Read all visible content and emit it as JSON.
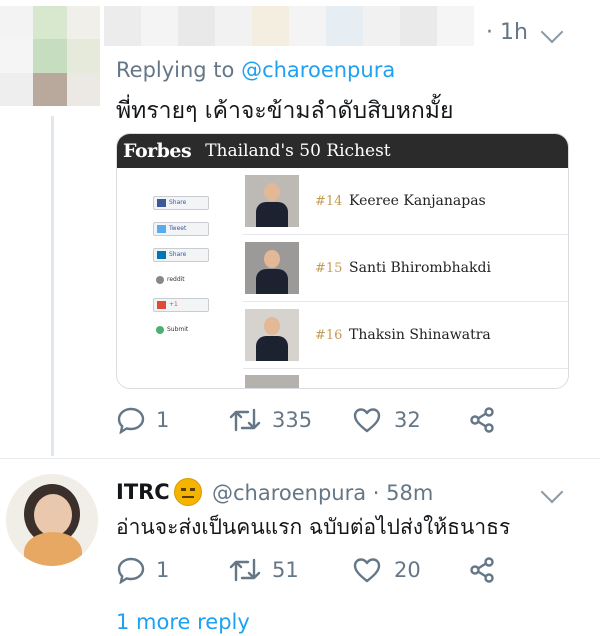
{
  "tweet1": {
    "time": "· 1h",
    "replying_prefix": "Replying to ",
    "replying_handle": "@charoenpura",
    "text": "พี่ทรายๆ เค้าจะข้ามลำดับสิบหกมั้ย",
    "card": {
      "logo": "Forbes",
      "title": "Thailand's 50 Richest",
      "share_buttons": [
        "Share",
        "Tweet",
        "Share",
        "reddit",
        "+1",
        "Submit"
      ],
      "people": [
        {
          "rank": "#14",
          "name": "Keeree Kanjanapas"
        },
        {
          "rank": "#15",
          "name": "Santi Bhirombhakdi"
        },
        {
          "rank": "#16",
          "name": "Thaksin Shinawatra"
        }
      ]
    },
    "actions": {
      "replies": "1",
      "retweets": "335",
      "likes": "32"
    }
  },
  "tweet2": {
    "name": "ITRC",
    "handle_time": "@charoenpura · 58m",
    "text": "อ่านจะส่งเป็นคนแรก ฉบับต่อไปส่งให้ธนาธร",
    "actions": {
      "replies": "1",
      "retweets": "51",
      "likes": "20"
    }
  },
  "more_replies": "1 more reply",
  "colors": {
    "accent": "#1da1f2",
    "muted": "#657786",
    "text": "#14171a",
    "card_header": "#2b2b2b",
    "rank_gold": "#c59b52"
  }
}
